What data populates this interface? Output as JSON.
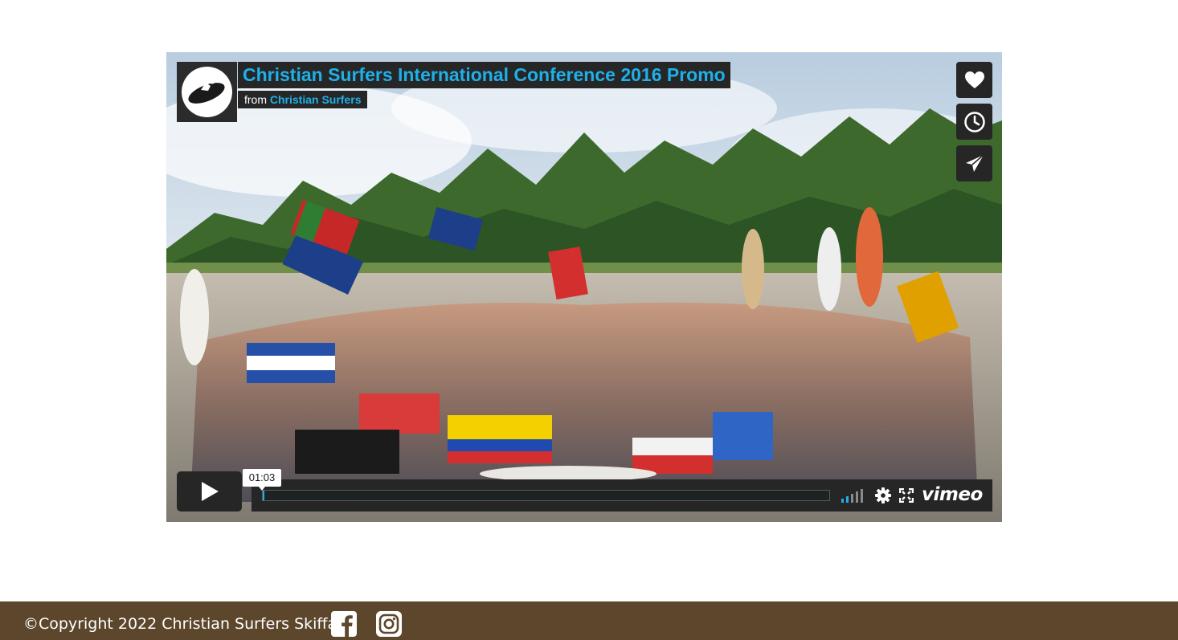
{
  "video": {
    "title": "Christian Surfers International Conference 2016 Promo",
    "byline_prefix": "from",
    "owner": "Christian Surfers",
    "time_tooltip": "01:03",
    "progress_fraction": 0.002,
    "volume_bars_lit": 2,
    "volume_bars_total": 5,
    "brand": "vimeo",
    "accent_color": "#1fb0ea",
    "icons": {
      "avatar": "surfer-logo-icon",
      "like": "heart-icon",
      "watch_later": "clock-icon",
      "share": "paper-plane-icon",
      "play": "play-icon",
      "volume": "volume-bars-icon",
      "settings": "gear-icon",
      "fullscreen": "fullscreen-icon"
    }
  },
  "footer": {
    "copyright": "©Copyright 2022 Christian Surfers Skiffa",
    "background_color": "#5d472c",
    "social_icons": [
      "facebook-icon",
      "instagram-icon"
    ]
  }
}
